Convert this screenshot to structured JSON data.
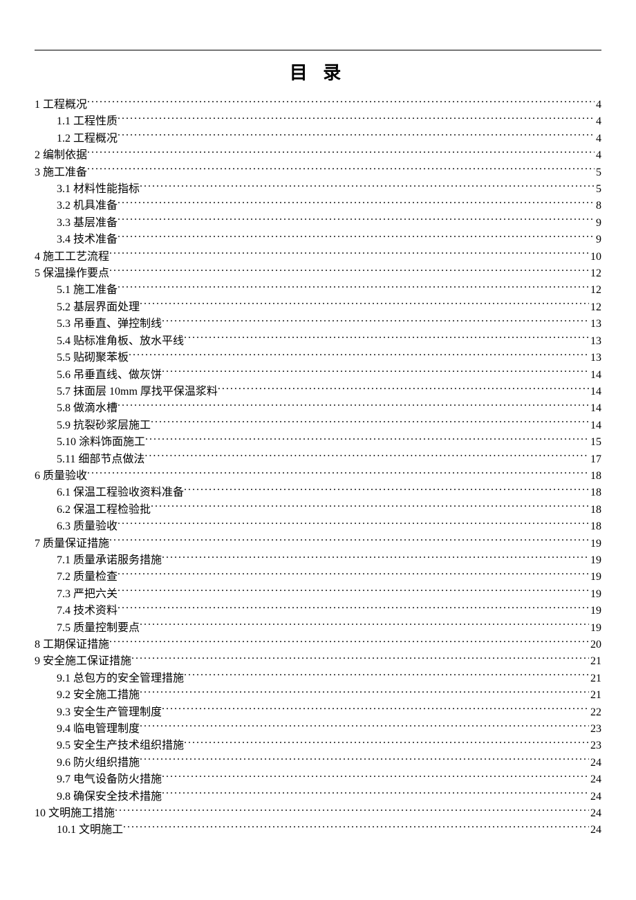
{
  "title": "目 录",
  "toc": [
    {
      "level": 1,
      "num": "1",
      "text": " 工程概况",
      "page": "4"
    },
    {
      "level": 2,
      "num": "1.1",
      "text": " 工程性质",
      "page": "4"
    },
    {
      "level": 2,
      "num": "1.2",
      "text": " 工程概况",
      "page": "4"
    },
    {
      "level": 1,
      "num": "2",
      "text": " 编制依据",
      "page": "4"
    },
    {
      "level": 1,
      "num": "3",
      "text": " 施工准备",
      "page": "5"
    },
    {
      "level": 2,
      "num": "3.1",
      "text": " 材料性能指标",
      "page": "5"
    },
    {
      "level": 2,
      "num": "3.2",
      "text": " 机具准备",
      "page": "8"
    },
    {
      "level": 2,
      "num": "3.3",
      "text": " 基层准备",
      "page": "9"
    },
    {
      "level": 2,
      "num": "3.4",
      "text": " 技术准备",
      "page": "9"
    },
    {
      "level": 1,
      "num": "4",
      "text": " 施工工艺流程",
      "page": "10"
    },
    {
      "level": 1,
      "num": "5",
      "text": " 保温操作要点",
      "page": "12"
    },
    {
      "level": 2,
      "num": "5.1",
      "text": "  施工准备",
      "page": "12"
    },
    {
      "level": 2,
      "num": "5.2",
      "text": "  基层界面处理",
      "page": "12"
    },
    {
      "level": 2,
      "num": "5.3",
      "text": "  吊垂直、弹控制线",
      "page": "13"
    },
    {
      "level": 2,
      "num": "5.4",
      "text": "  贴标准角板、放水平线",
      "page": "13"
    },
    {
      "level": 2,
      "num": "5.5",
      "text": "  贴砌聚苯板",
      "page": "13"
    },
    {
      "level": 2,
      "num": "5.6",
      "text": "  吊垂直线、做灰饼",
      "page": "14"
    },
    {
      "level": 2,
      "num": "5.7",
      "text": "  抹面层 10mm 厚找平保温浆料 ",
      "page": "14"
    },
    {
      "level": 2,
      "num": "5.8",
      "text": "  做滴水槽",
      "page": "14"
    },
    {
      "level": 2,
      "num": "5.9",
      "text": "  抗裂砂浆层施工",
      "page": "14"
    },
    {
      "level": 2,
      "num": "5.10",
      "text": "  涂料饰面施工",
      "page": "15"
    },
    {
      "level": 2,
      "num": "5.11",
      "text": "  细部节点做法",
      "page": "17"
    },
    {
      "level": 1,
      "num": "6",
      "text": " 质量验收",
      "page": "18"
    },
    {
      "level": 2,
      "num": "6.1",
      "text": " 保温工程验收资料准备",
      "page": "18"
    },
    {
      "level": 2,
      "num": "6.2",
      "text": " 保温工程检验批",
      "page": "18"
    },
    {
      "level": 2,
      "num": "6.3",
      "text": " 质量验收",
      "page": "18"
    },
    {
      "level": 1,
      "num": "7",
      "text": " 质量保证措施",
      "page": "19"
    },
    {
      "level": 2,
      "num": "7.1",
      "text": " 质量承诺服务措施 ",
      "page": "19"
    },
    {
      "level": 2,
      "num": "7.2",
      "text": " 质量检查",
      "page": "19"
    },
    {
      "level": 2,
      "num": "7.3",
      "text": " 严把六关",
      "page": "19"
    },
    {
      "level": 2,
      "num": "7.4",
      "text": " 技术资料",
      "page": "19"
    },
    {
      "level": 2,
      "num": "7.5",
      "text": " 质量控制要点",
      "page": "19"
    },
    {
      "level": 1,
      "num": "8",
      "text": " 工期保证措施",
      "page": "20"
    },
    {
      "level": 1,
      "num": "9",
      "text": " 安全施工保证措施",
      "page": "21"
    },
    {
      "level": 2,
      "num": "9.1",
      "text": " 总包方的安全管理措施",
      "page": "21"
    },
    {
      "level": 2,
      "num": "9.2",
      "text": " 安全施工措施",
      "page": "21"
    },
    {
      "level": 2,
      "num": "9.3",
      "text": " 安全生产管理制度",
      "page": "22"
    },
    {
      "level": 2,
      "num": "9.4",
      "text": " 临电管理制度",
      "page": "23"
    },
    {
      "level": 2,
      "num": "9.5",
      "text": " 安全生产技术组织措施",
      "page": "23"
    },
    {
      "level": 2,
      "num": "9.6",
      "text": " 防火组织措施",
      "page": "24"
    },
    {
      "level": 2,
      "num": "9.7",
      "text": " 电气设备防火措施",
      "page": "24"
    },
    {
      "level": 2,
      "num": "9.8",
      "text": " 确保安全技术措施",
      "page": "24"
    },
    {
      "level": 1,
      "num": "10",
      "text": " 文明施工措施",
      "page": "24"
    },
    {
      "level": 2,
      "num": "10.1",
      "text": " 文明施工",
      "page": "24"
    }
  ]
}
